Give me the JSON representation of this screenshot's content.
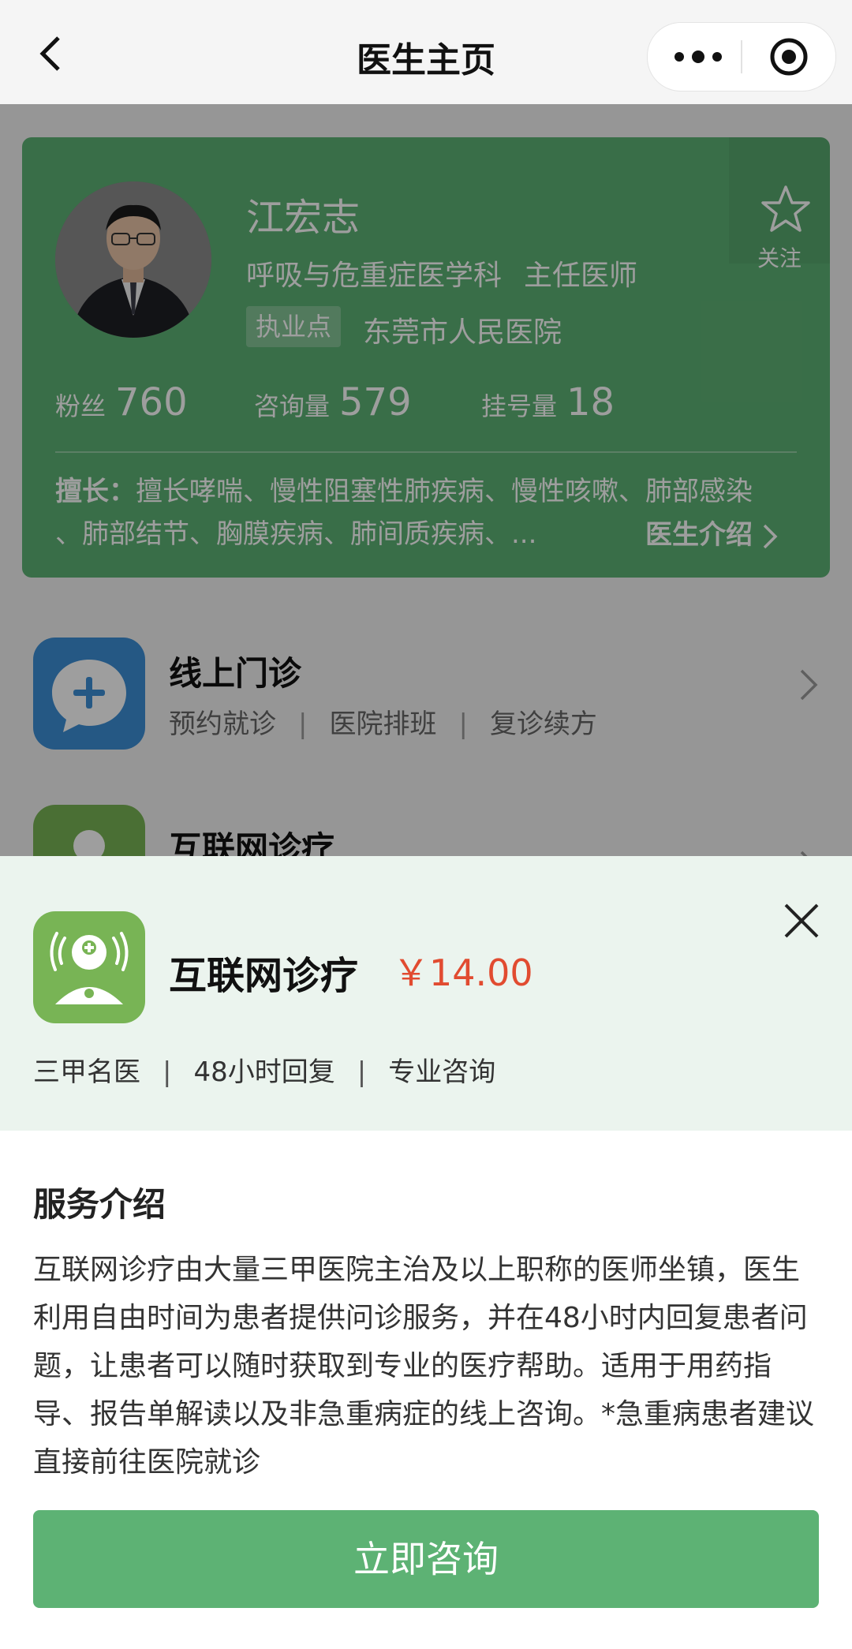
{
  "navbar": {
    "title": "医生主页"
  },
  "doctor": {
    "name": "江宏志",
    "department": "呼吸与危重症医学科",
    "title": "主任医师",
    "practice_tag": "执业点",
    "hospital": "东莞市人民医院",
    "follow_label": "关注",
    "stats": [
      {
        "label": "粉丝",
        "value": "760"
      },
      {
        "label": "咨询量",
        "value": "579"
      },
      {
        "label": "挂号量",
        "value": "18"
      }
    ],
    "specialty_prefix": "擅长：",
    "specialty_line1": "擅长哮喘、慢性阻塞性肺疾病、慢性咳嗽、肺部感染",
    "specialty_line2": "、肺部结节、胸膜疾病、肺间质疾病、...",
    "intro_link": "医生介绍"
  },
  "services": [
    {
      "title": "线上门诊",
      "subs": [
        "预约就诊",
        "医院排班",
        "复诊续方"
      ],
      "icon": "chat-plus-icon",
      "color": "#3d8fd6"
    },
    {
      "title": "互联网诊疗",
      "icon": "doctor-icon",
      "color": "#78b455"
    }
  ],
  "sheet": {
    "title": "互联网诊疗",
    "price": "￥14.00",
    "tags": [
      "三甲名医",
      "48小时回复",
      "专业咨询"
    ],
    "section_title": "服务介绍",
    "description": "互联网诊疗由大量三甲医院主治及以上职称的医师坐镇，医生利用自由时间为患者提供问诊服务，并在48小时内回复患者问题，让患者可以随时获取到专业的医疗帮助。适用于用药指导、报告单解读以及非急重病症的线上咨询。*急重病患者建议直接前往医院就诊",
    "cta": "立即咨询",
    "price_color": "#e14b30",
    "accent": "#5db274"
  }
}
